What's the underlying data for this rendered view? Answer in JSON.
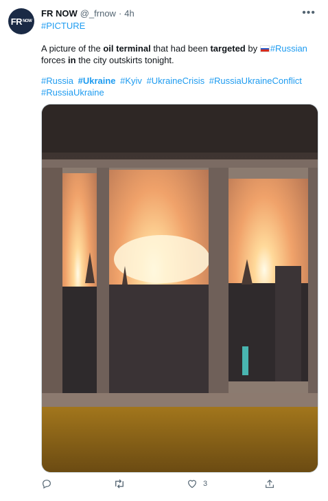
{
  "tweet": {
    "avatar_text": "FR",
    "avatar_subtext": "NOW",
    "author_name": "FR NOW",
    "handle": "@_frnow",
    "separator": "·",
    "time": "4h",
    "lead_tag": "#PICTURE",
    "text": {
      "part1": "A picture of the ",
      "bold1": "oil terminal",
      "part2": " that had been ",
      "bold2": "targeted",
      "part3": " by ",
      "link1": "#Russian",
      "part4": " forces ",
      "bold3": "in",
      "part5": " the city outskirts tonight."
    },
    "hashtags": [
      "#Russia",
      "#Ukraine",
      "#Kyiv",
      "#UkraineCrisis",
      "#RussiaUkraineConflict",
      "#RussiaUkraine"
    ],
    "like_count": "3"
  },
  "colors": {
    "link": "#1d9bf0",
    "muted": "#536471",
    "avatar_bg": "#1a2a45"
  },
  "icons": [
    "more-icon",
    "russia-flag-icon",
    "reply-icon",
    "retweet-icon",
    "like-icon",
    "share-icon"
  ]
}
